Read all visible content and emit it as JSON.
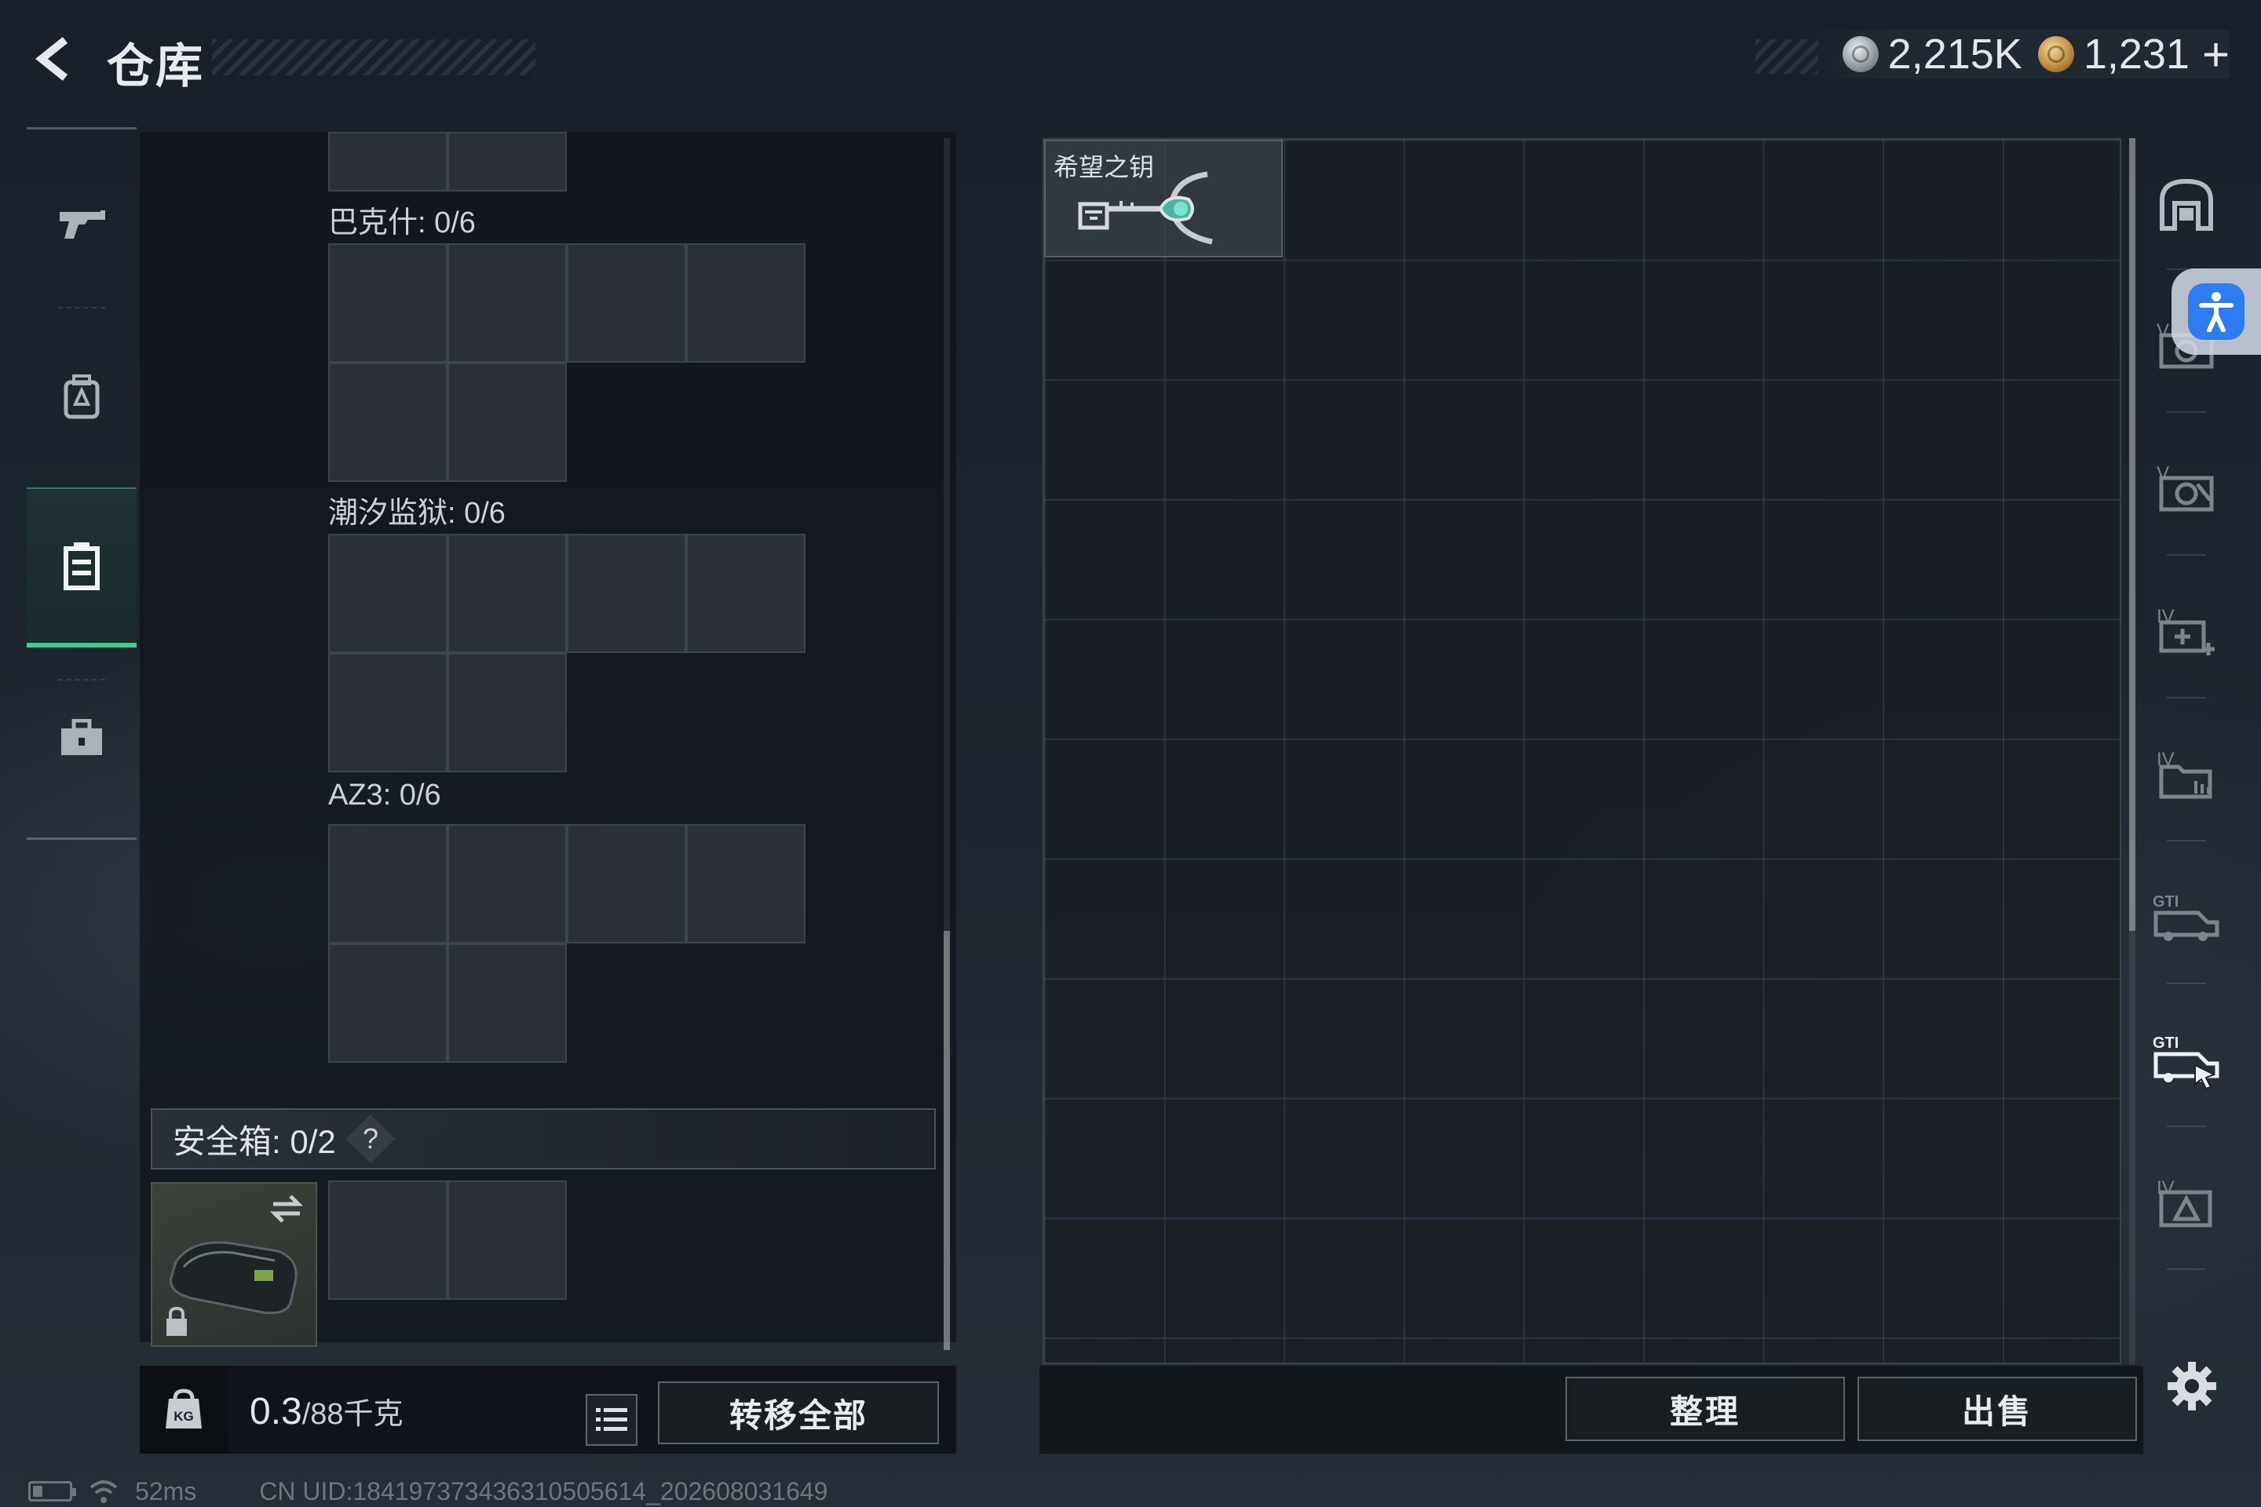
{
  "header": {
    "title": "仓库",
    "currencies": [
      {
        "icon": "silver-coin-icon",
        "value": "2,215K"
      },
      {
        "icon": "gold-coin-icon",
        "value": "1,231"
      }
    ],
    "add_label": "+"
  },
  "left_nav": [
    {
      "icon": "gun-icon",
      "active": false
    },
    {
      "icon": "backpack-icon",
      "active": false
    },
    {
      "icon": "container-icon",
      "active": true
    },
    {
      "icon": "briefcase-icon",
      "active": false
    }
  ],
  "key_sections": [
    {
      "label": "巴克什: 0/6"
    },
    {
      "label": "潮汐监狱: 0/6"
    },
    {
      "label": "AZ3: 0/6"
    }
  ],
  "safe_box": {
    "label": "安全箱: 0/2",
    "help": "?"
  },
  "weight": {
    "current": "0.3",
    "max": "/88千克"
  },
  "buttons": {
    "transfer_all": "转移全部",
    "sort": "整理",
    "sell": "出售"
  },
  "stash": {
    "items": [
      {
        "name": "希望之钥",
        "icon": "key-icon"
      }
    ]
  },
  "right_rail": [
    {
      "icon": "arch-icon"
    },
    {
      "icon": "level-v-gear-icon"
    },
    {
      "icon": "level-v-gear-icon"
    },
    {
      "icon": "level-iv-medkit-icon"
    },
    {
      "icon": "level-iv-folder-icon"
    },
    {
      "icon": "gti-vehicle-icon"
    },
    {
      "icon": "gti-vehicle-selected-icon"
    },
    {
      "icon": "level-iv-map-icon"
    }
  ],
  "status_bar": {
    "ping": "52ms",
    "uid": "CN UID:1841973734363105056​14_202608031649"
  },
  "colors": {
    "accent_green": "#3cd08c",
    "accessibility_blue": "#2e7df0"
  }
}
